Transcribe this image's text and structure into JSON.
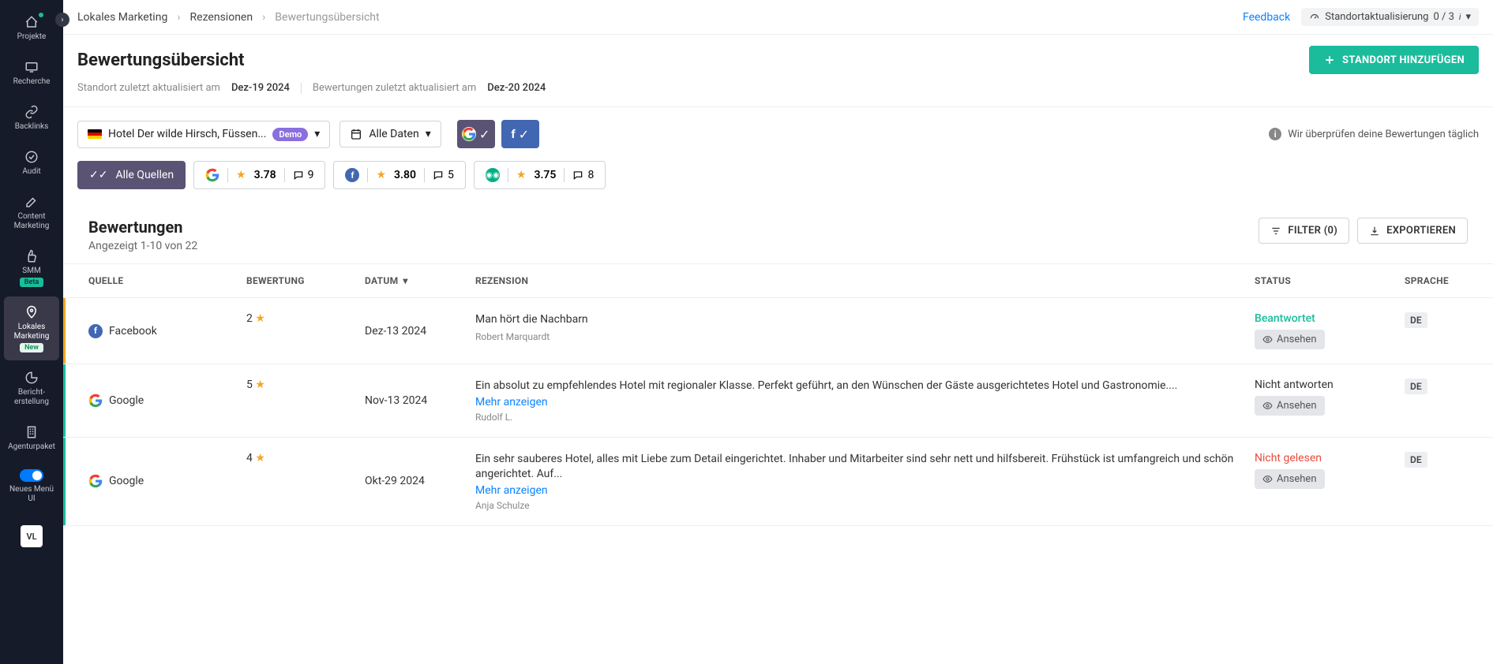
{
  "sidebar": {
    "items": [
      {
        "label": "Projekte"
      },
      {
        "label": "Recherche"
      },
      {
        "label": "Backlinks"
      },
      {
        "label": "Audit"
      },
      {
        "label": "Content Marketing"
      },
      {
        "label": "SMM",
        "badge": "Beta"
      },
      {
        "label": "Lokales Marketing",
        "badge": "New"
      },
      {
        "label": "Bericht-erstellung"
      },
      {
        "label": "Agenturpaket"
      },
      {
        "label": "Neues Menü UI"
      }
    ],
    "avatar": "VL"
  },
  "breadcrumb": {
    "a": "Lokales Marketing",
    "b": "Rezensionen",
    "c": "Bewertungsübersicht"
  },
  "topbar": {
    "feedback": "Feedback",
    "location_update_label": "Standortaktualisierung",
    "location_update_count": "0 / 3"
  },
  "header": {
    "title": "Bewertungsübersicht",
    "add_btn": "STANDORT HINZUFÜGEN",
    "loc_updated_label": "Standort zuletzt aktualisiert am",
    "loc_updated_date": "Dez-19 2024",
    "rev_updated_label": "Bewertungen zuletzt aktualisiert am",
    "rev_updated_date": "Dez-20 2024"
  },
  "toolbar": {
    "location_label": "Hotel Der wilde Hirsch, Füssen...",
    "demo_tag": "Demo",
    "date_label": "Alle Daten",
    "info_text": "Wir überprüfen deine Bewertungen täglich"
  },
  "sources": {
    "all_label": "Alle Quellen",
    "google": {
      "rating": "3.78",
      "count": "9"
    },
    "facebook": {
      "rating": "3.80",
      "count": "5"
    },
    "tripadvisor": {
      "rating": "3.75",
      "count": "8"
    }
  },
  "section": {
    "title": "Bewertungen",
    "subtitle": "Angezeigt 1-10 von 22",
    "filter_btn": "FILTER (0)",
    "export_btn": "EXPORTIEREN"
  },
  "table": {
    "headers": {
      "source": "QUELLE",
      "rating": "BEWERTUNG",
      "date": "DATUM",
      "review": "REZENSION",
      "status": "STATUS",
      "lang": "SPRACHE"
    },
    "rows": [
      {
        "source": "Facebook",
        "rating": "2",
        "date": "Dez-13 2024",
        "text": "Man hört die Nachbarn",
        "author": "Robert Marquardt",
        "status": "Beantwortet",
        "view": "Ansehen",
        "lang": "DE"
      },
      {
        "source": "Google",
        "rating": "5",
        "date": "Nov-13 2024",
        "text": "Ein absolut zu empfehlendes Hotel mit regionaler Klasse. Perfekt geführt, an den Wünschen der Gäste ausgerichtetes Hotel und Gastronomie....",
        "more": "Mehr anzeigen",
        "author": "Rudolf L.",
        "status": "Nicht antworten",
        "view": "Ansehen",
        "lang": "DE"
      },
      {
        "source": "Google",
        "rating": "4",
        "date": "Okt-29 2024",
        "text": "Ein sehr sauberes Hotel, alles mit Liebe zum Detail eingerichtet. Inhaber und Mitarbeiter sind sehr nett und hilfsbereit. Frühstück ist umfangreich und schön angerichtet. Auf...",
        "more": "Mehr anzeigen",
        "author": "Anja Schulze",
        "status": "Nicht gelesen",
        "view": "Ansehen",
        "lang": "DE"
      }
    ]
  }
}
